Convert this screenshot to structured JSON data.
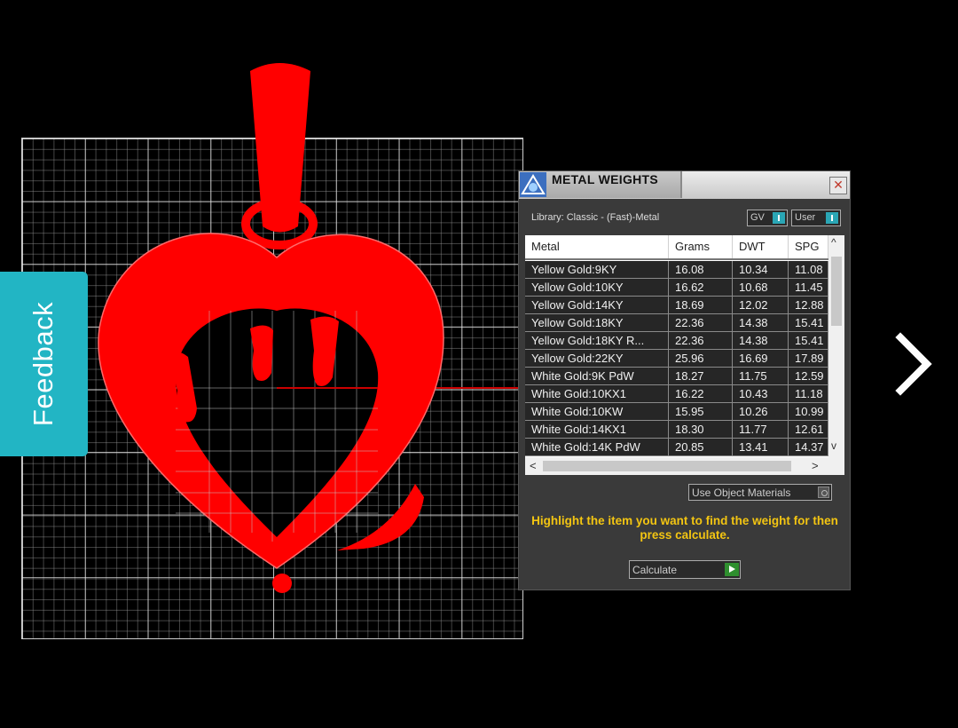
{
  "feedback": {
    "label": "Feedback"
  },
  "dialog": {
    "title": "METAL WEIGHTS",
    "close_glyph": "✕",
    "library_label": "Library: Classic - (Fast)-Metal",
    "toggles": {
      "gv": "GV",
      "user": "User"
    },
    "table": {
      "columns": [
        "Metal",
        "Grams",
        "DWT",
        "SPG"
      ],
      "rows": [
        [
          "Yellow Gold:9KY",
          "16.08",
          "10.34",
          "11.08"
        ],
        [
          "Yellow Gold:10KY",
          "16.62",
          "10.68",
          "11.45"
        ],
        [
          "Yellow Gold:14KY",
          "18.69",
          "12.02",
          "12.88"
        ],
        [
          "Yellow Gold:18KY",
          "22.36",
          "14.38",
          "15.41"
        ],
        [
          "Yellow Gold:18KY R...",
          "22.36",
          "14.38",
          "15.41"
        ],
        [
          "Yellow Gold:22KY",
          "25.96",
          "16.69",
          "17.89"
        ],
        [
          "White Gold:9K PdW",
          "18.27",
          "11.75",
          "12.59"
        ],
        [
          "White Gold:10KX1",
          "16.22",
          "10.43",
          "11.18"
        ],
        [
          "White Gold:10KW",
          "15.95",
          "10.26",
          "10.99"
        ],
        [
          "White Gold:14KX1",
          "18.30",
          "11.77",
          "12.61"
        ],
        [
          "White Gold:14K PdW",
          "20.85",
          "13.41",
          "14.37"
        ]
      ]
    },
    "use_object_materials": "Use Object Materials",
    "instructions": "Highlight the item you want to find the weight for then press calculate.",
    "calculate_label": "Calculate",
    "scroll": {
      "up": "^",
      "down": "v",
      "left": "<",
      "right": ">"
    }
  },
  "colors": {
    "model": "#ff0000",
    "feedback_bg": "#22b5c4",
    "instruction_text": "#f3c512"
  },
  "icons": {
    "next": "chevron-right-icon",
    "app": "app-logo-icon",
    "close": "close-icon"
  }
}
